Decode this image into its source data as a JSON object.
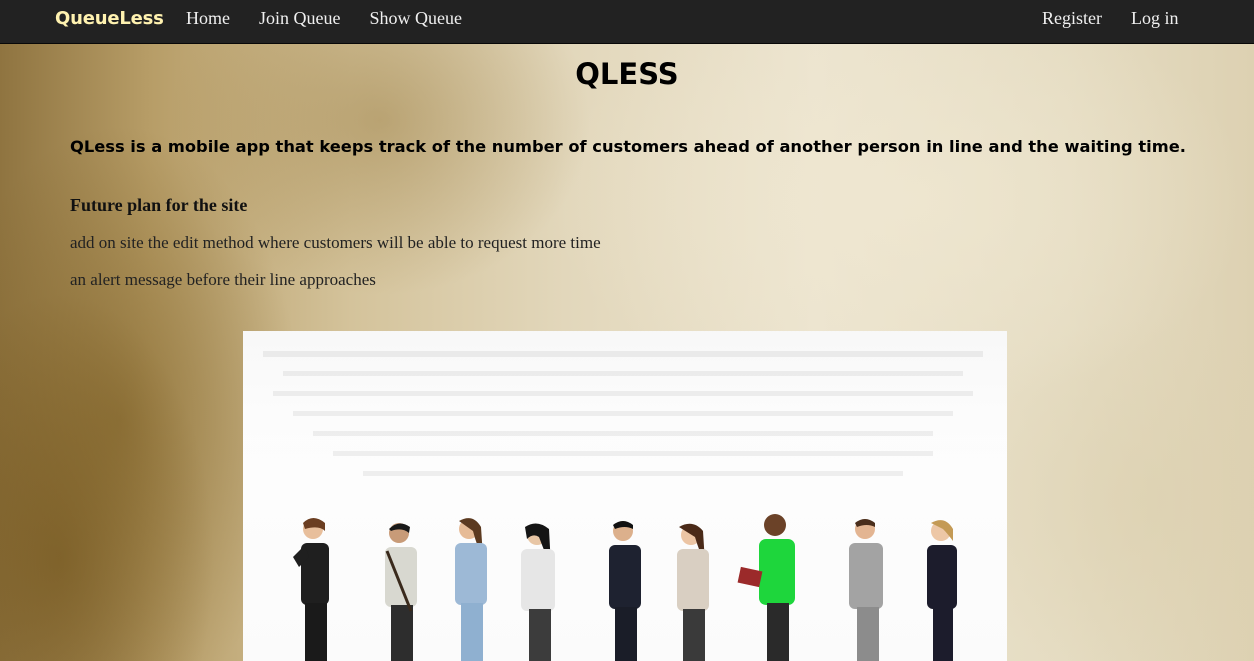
{
  "nav": {
    "brand": "QueueLess",
    "left_links": [
      "Home",
      "Join Queue",
      "Show Queue"
    ],
    "right_links": [
      "Register",
      "Log in"
    ]
  },
  "main": {
    "title": "QLESS",
    "lead": "QLess is a mobile app that keeps track of the number of customers ahead of another person in line and the waiting time.",
    "subhead": "Future plan for the site",
    "plan_items": [
      "add on site the edit method where customers will be able to request more time",
      "an alert message before their line approaches"
    ]
  }
}
